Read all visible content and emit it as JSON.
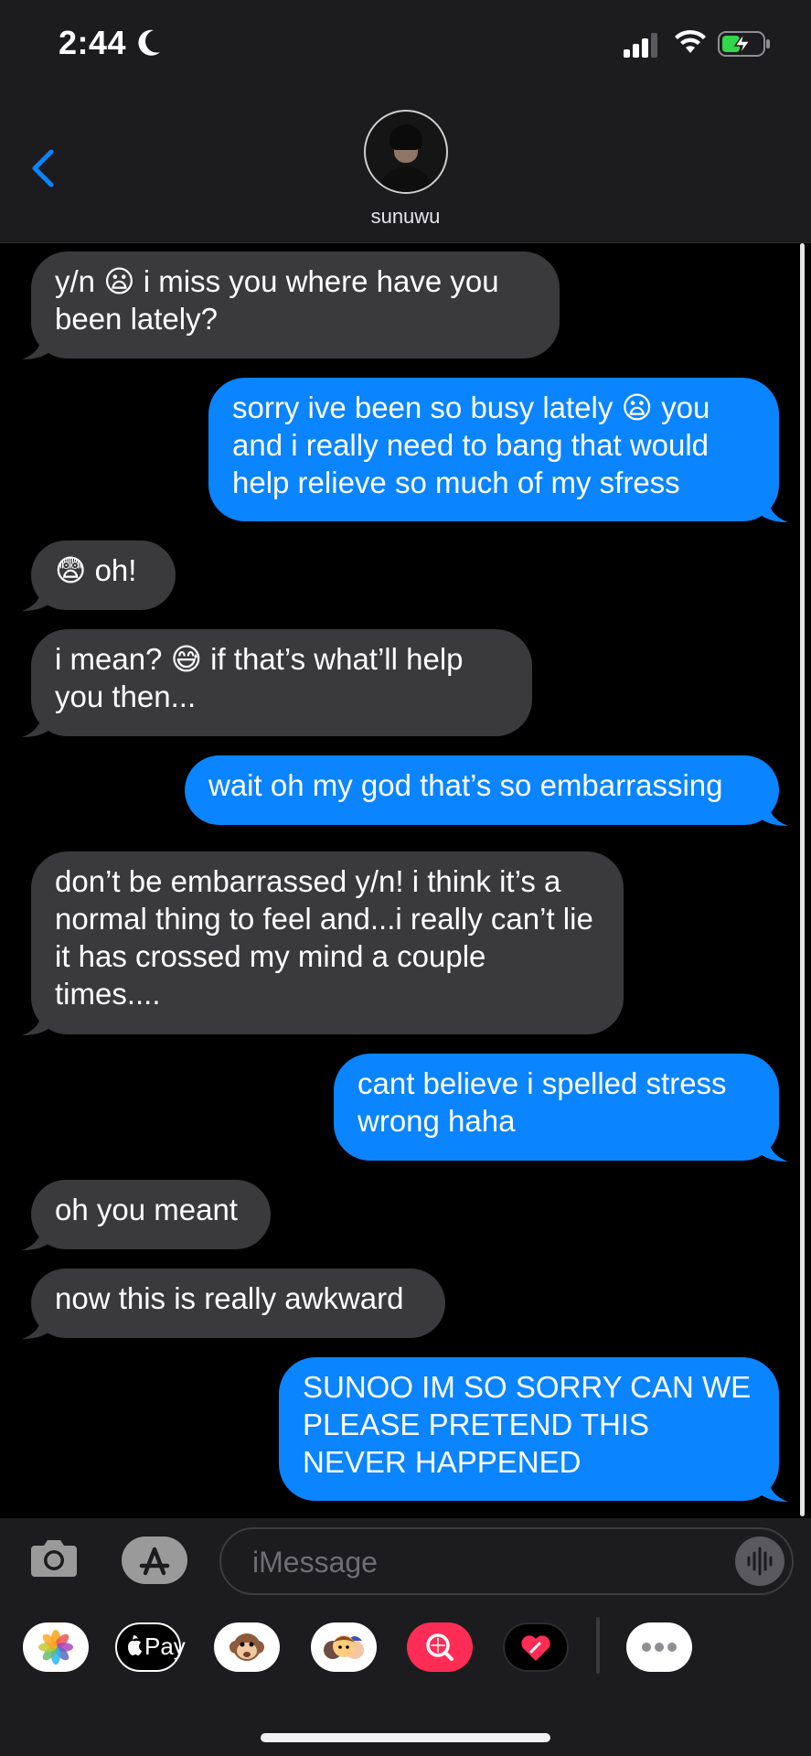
{
  "status": {
    "time": "2:44"
  },
  "contact": {
    "name": "sunuwu"
  },
  "messages": [
    {
      "side": "in",
      "text": "y/n 😦 i miss you where have you been lately?"
    },
    {
      "side": "out",
      "text": "sorry ive been so busy lately 😦 you and i really need to bang that would help relieve so much of my sfress"
    },
    {
      "side": "in",
      "text": "😨 oh!"
    },
    {
      "side": "in",
      "text": "i mean? 😅 if that’s what’ll help you then..."
    },
    {
      "side": "out",
      "text": "wait oh my god that’s so embarrassing"
    },
    {
      "side": "in",
      "text": "don’t be embarrassed y/n! i think it’s a normal thing to feel and...i really can’t lie it has crossed my mind a couple times...."
    },
    {
      "side": "out",
      "text": "cant believe i spelled stress wrong haha"
    },
    {
      "side": "in",
      "text": "oh you meant"
    },
    {
      "side": "in",
      "text": "now this is really awkward"
    },
    {
      "side": "out",
      "text": "SUNOO IM SO SORRY CAN WE PLEASE PRETEND THIS NEVER HAPPENED"
    }
  ],
  "input": {
    "placeholder": "iMessage"
  },
  "apps": [
    {
      "name": "photos-app-icon"
    },
    {
      "name": "apple-pay-app-icon",
      "label": "Pay"
    },
    {
      "name": "animoji-app-icon"
    },
    {
      "name": "memoji-app-icon"
    },
    {
      "name": "images-search-app-icon"
    },
    {
      "name": "digital-touch-app-icon"
    },
    {
      "name": "more-apps-icon"
    }
  ]
}
